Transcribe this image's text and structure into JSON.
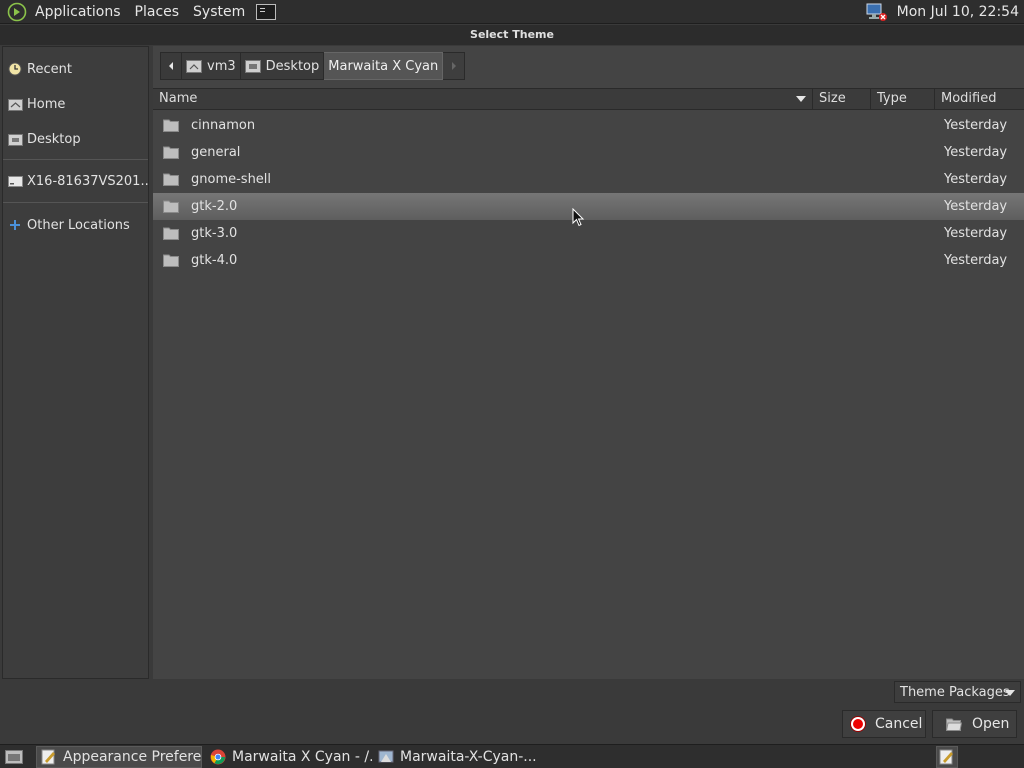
{
  "top_panel": {
    "menu": [
      "Applications",
      "Places",
      "System"
    ],
    "clock": "Mon Jul 10, 22:54"
  },
  "dialog": {
    "title": "Select Theme"
  },
  "sidebar": {
    "items": [
      {
        "label": "Recent",
        "icon": "recent-icon"
      },
      {
        "label": "Home",
        "icon": "home-icon"
      },
      {
        "label": "Desktop",
        "icon": "desktop-folder-icon"
      },
      {
        "label": "X16-81637VS201...",
        "icon": "drive-icon"
      },
      {
        "label": "Other Locations",
        "icon": "plus-icon"
      }
    ]
  },
  "pathbar": {
    "crumbs": [
      "vm3",
      "Desktop",
      "Marwaita X Cyan"
    ]
  },
  "columns": {
    "name": "Name",
    "size": "Size",
    "type": "Type",
    "modified": "Modified"
  },
  "files": [
    {
      "name": "cinnamon",
      "modified": "Yesterday"
    },
    {
      "name": "general",
      "modified": "Yesterday"
    },
    {
      "name": "gnome-shell",
      "modified": "Yesterday"
    },
    {
      "name": "gtk-2.0",
      "modified": "Yesterday",
      "selected": true
    },
    {
      "name": "gtk-3.0",
      "modified": "Yesterday"
    },
    {
      "name": "gtk-4.0",
      "modified": "Yesterday"
    }
  ],
  "filter": {
    "selected": "Theme Packages"
  },
  "buttons": {
    "cancel": "Cancel",
    "open": "Open"
  },
  "taskbar": {
    "tasks": [
      "Appearance Prefere...",
      "Marwaita X Cyan - /...",
      "Marwaita-X-Cyan-..."
    ]
  },
  "colors": {
    "selection": "#6b6b6b",
    "cancel_icon": "#e00000"
  }
}
